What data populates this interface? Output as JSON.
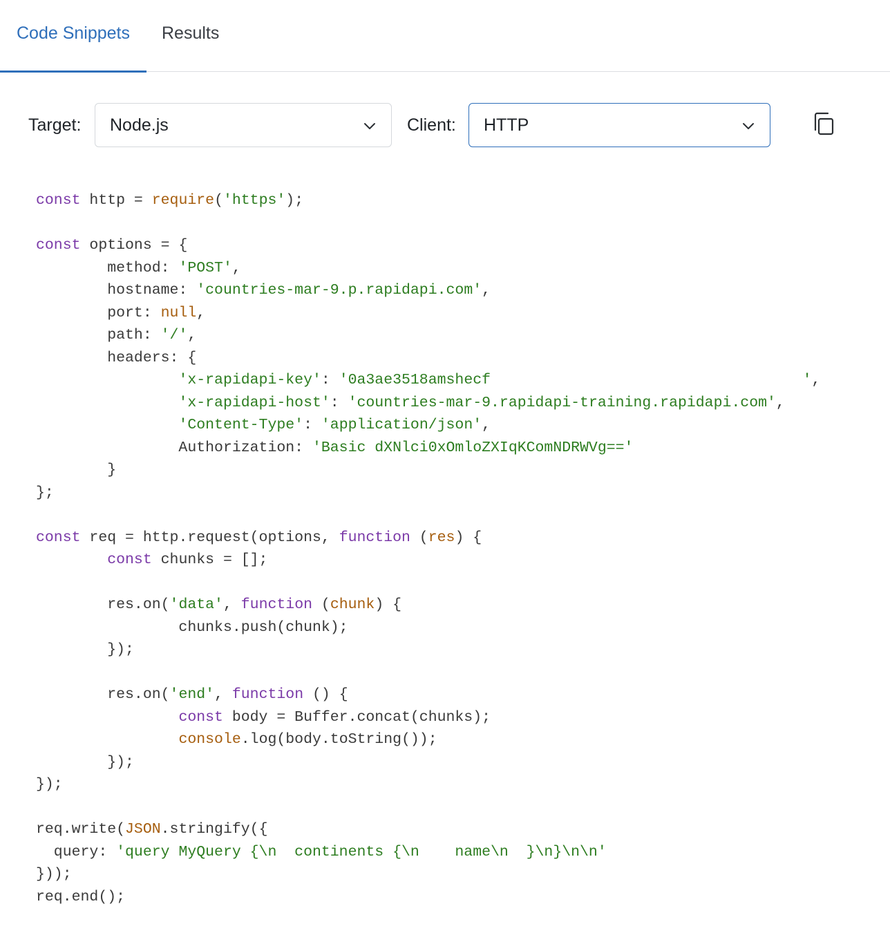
{
  "tabs": {
    "code_snippets": "Code Snippets",
    "results": "Results"
  },
  "toolbar": {
    "target_label": "Target:",
    "target_value": "Node.js",
    "client_label": "Client:",
    "client_value": "HTTP"
  },
  "icons": {
    "copy": "copy-icon",
    "chevron": "chevron-down-icon"
  },
  "colors": {
    "accent": "#2f6fba",
    "keyword": "#7b3aa8",
    "builtin": "#a65e0f",
    "string": "#2d7d20",
    "plain": "#3a3a3a"
  },
  "code_lines": [
    [
      [
        "kw",
        "const"
      ],
      [
        "pl",
        " http = "
      ],
      [
        "fn",
        "require"
      ],
      [
        "pl",
        "("
      ],
      [
        "str",
        "'https'"
      ],
      [
        "pl",
        ");"
      ]
    ],
    [],
    [
      [
        "kw",
        "const"
      ],
      [
        "pl",
        " options = {"
      ]
    ],
    [
      [
        "pl",
        "        method: "
      ],
      [
        "str",
        "'POST'"
      ],
      [
        "pl",
        ","
      ]
    ],
    [
      [
        "pl",
        "        hostname: "
      ],
      [
        "str",
        "'countries-mar-9.p.rapidapi.com'"
      ],
      [
        "pl",
        ","
      ]
    ],
    [
      [
        "pl",
        "        port: "
      ],
      [
        "fn",
        "null"
      ],
      [
        "pl",
        ","
      ]
    ],
    [
      [
        "pl",
        "        path: "
      ],
      [
        "str",
        "'/'"
      ],
      [
        "pl",
        ","
      ]
    ],
    [
      [
        "pl",
        "        headers: {"
      ]
    ],
    [
      [
        "pl",
        "                "
      ],
      [
        "str",
        "'x-rapidapi-key'"
      ],
      [
        "pl",
        ": "
      ],
      [
        "str",
        "'0a3ae3518amshecf                                   '"
      ],
      [
        "pl",
        ","
      ]
    ],
    [
      [
        "pl",
        "                "
      ],
      [
        "str",
        "'x-rapidapi-host'"
      ],
      [
        "pl",
        ": "
      ],
      [
        "str",
        "'countries-mar-9.rapidapi-training.rapidapi.com'"
      ],
      [
        "pl",
        ","
      ]
    ],
    [
      [
        "pl",
        "                "
      ],
      [
        "str",
        "'Content-Type'"
      ],
      [
        "pl",
        ": "
      ],
      [
        "str",
        "'application/json'"
      ],
      [
        "pl",
        ","
      ]
    ],
    [
      [
        "pl",
        "                Authorization: "
      ],
      [
        "str",
        "'Basic dXNlci0xOmloZXIqKComNDRWVg=='"
      ]
    ],
    [
      [
        "pl",
        "        }"
      ]
    ],
    [
      [
        "pl",
        "};"
      ]
    ],
    [],
    [
      [
        "kw",
        "const"
      ],
      [
        "pl",
        " req = http.request(options, "
      ],
      [
        "kw",
        "function"
      ],
      [
        "pl",
        " ("
      ],
      [
        "fn",
        "res"
      ],
      [
        "pl",
        ") {"
      ]
    ],
    [
      [
        "pl",
        "        "
      ],
      [
        "kw",
        "const"
      ],
      [
        "pl",
        " chunks = [];"
      ]
    ],
    [],
    [
      [
        "pl",
        "        res.on("
      ],
      [
        "str",
        "'data'"
      ],
      [
        "pl",
        ", "
      ],
      [
        "kw",
        "function"
      ],
      [
        "pl",
        " ("
      ],
      [
        "fn",
        "chunk"
      ],
      [
        "pl",
        ") {"
      ]
    ],
    [
      [
        "pl",
        "                chunks.push(chunk);"
      ]
    ],
    [
      [
        "pl",
        "        });"
      ]
    ],
    [],
    [
      [
        "pl",
        "        res.on("
      ],
      [
        "str",
        "'end'"
      ],
      [
        "pl",
        ", "
      ],
      [
        "kw",
        "function"
      ],
      [
        "pl",
        " () {"
      ]
    ],
    [
      [
        "pl",
        "                "
      ],
      [
        "kw",
        "const"
      ],
      [
        "pl",
        " body = Buffer.concat(chunks);"
      ]
    ],
    [
      [
        "pl",
        "                "
      ],
      [
        "fn",
        "console"
      ],
      [
        "pl",
        ".log(body.toString());"
      ]
    ],
    [
      [
        "pl",
        "        });"
      ]
    ],
    [
      [
        "pl",
        "});"
      ]
    ],
    [],
    [
      [
        "pl",
        "req.write("
      ],
      [
        "fn",
        "JSON"
      ],
      [
        "pl",
        ".stringify({"
      ]
    ],
    [
      [
        "pl",
        "  query: "
      ],
      [
        "str",
        "'query MyQuery {\\n  continents {\\n    name\\n  }\\n}\\n\\n'"
      ]
    ],
    [
      [
        "pl",
        "}));"
      ]
    ],
    [
      [
        "pl",
        "req.end();"
      ]
    ]
  ]
}
